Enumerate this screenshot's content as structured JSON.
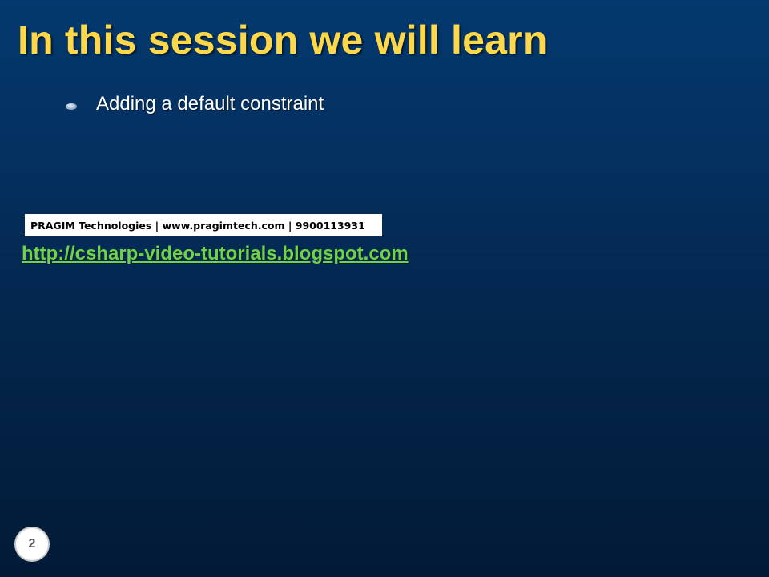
{
  "slide": {
    "title": "In this session we will learn",
    "bullets": [
      {
        "text": "Adding a default constraint"
      }
    ],
    "banner": "PRAGIM Technologies | www.pragimtech.com | 9900113931",
    "link": "http://csharp-video-tutorials.blogspot.com",
    "page_number": "2"
  },
  "colors": {
    "title": "#ffd84a",
    "link": "#6fd24a",
    "background_top": "#03396e",
    "background_bottom": "#021a36"
  },
  "icons": {
    "bullet": "ellipse-bullet-icon"
  }
}
